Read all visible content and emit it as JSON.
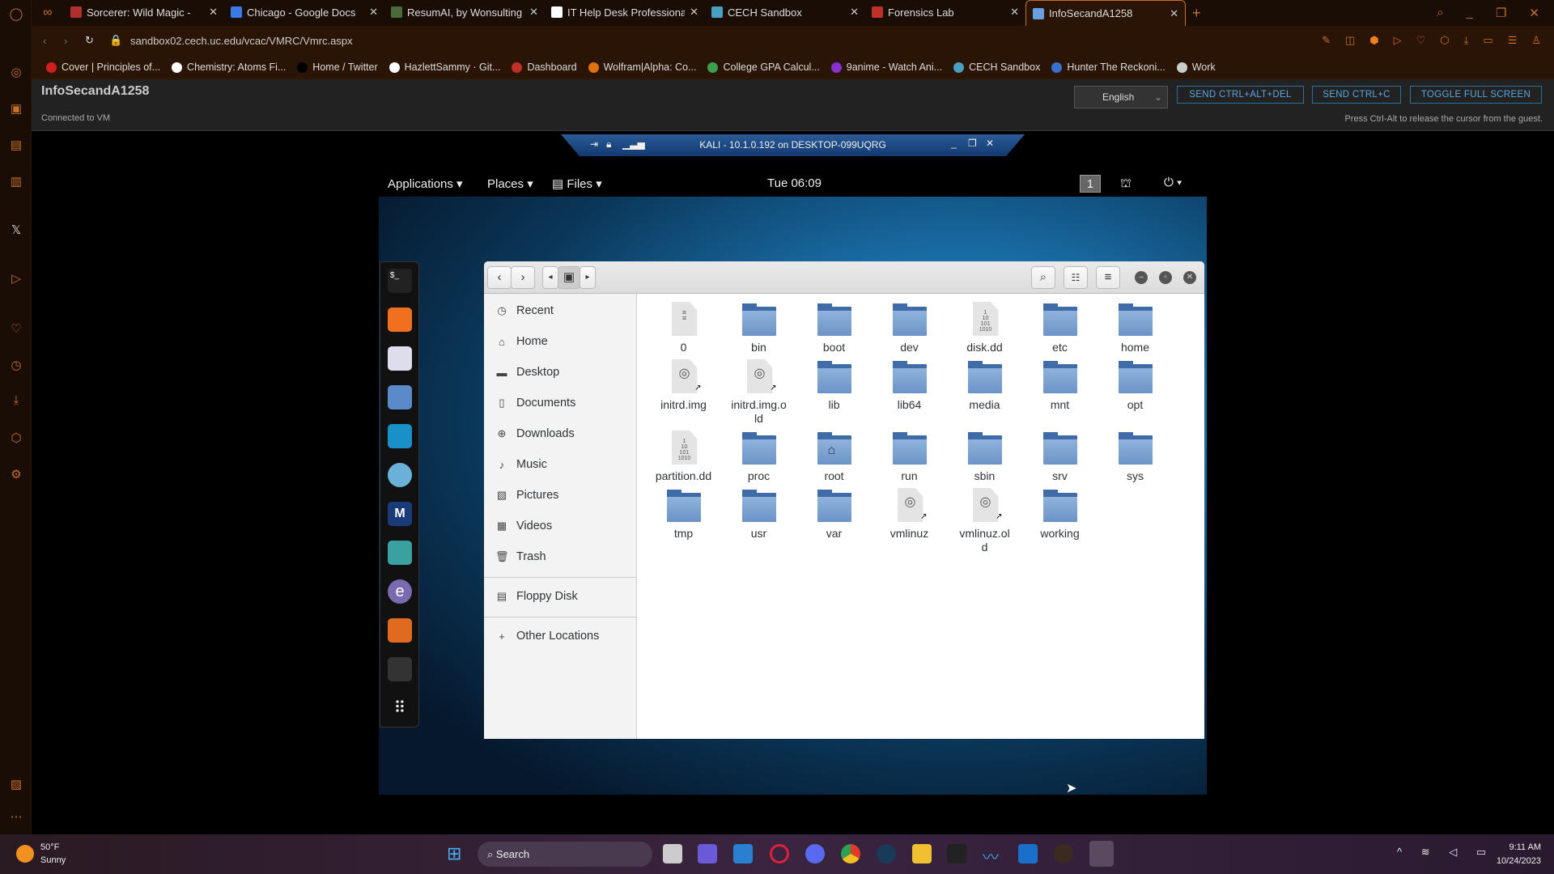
{
  "browser": {
    "tabs": [
      {
        "title": "Sorcerer: Wild Magic -",
        "color": "#b03030"
      },
      {
        "title": "Chicago - Google Docs",
        "color": "#3b7be8"
      },
      {
        "title": "ResumAI, by Wonsulting",
        "color": "#4a6a3a"
      },
      {
        "title": "IT Help Desk Professional",
        "color": "#ffffff"
      },
      {
        "title": "CECH Sandbox",
        "color": "#4aa0c0"
      },
      {
        "title": "Forensics Lab",
        "color": "#c0302a"
      },
      {
        "title": "InfoSecandA1258",
        "color": "#6aa0e0",
        "active": true
      }
    ],
    "url": "sandbox02.cech.uc.edu/vcac/VMRC/Vmrc.aspx",
    "bookmarks": [
      {
        "label": "Cover | Principles of...",
        "color": "#d02020"
      },
      {
        "label": "Chemistry: Atoms Fi...",
        "color": "#ffffff"
      },
      {
        "label": "Home / Twitter",
        "color": "#000000"
      },
      {
        "label": "HazlettSammy · Git...",
        "color": "#ffffff"
      },
      {
        "label": "Dashboard",
        "color": "#c0302a"
      },
      {
        "label": "Wolfram|Alpha: Co...",
        "color": "#e07010"
      },
      {
        "label": "College GPA Calcul...",
        "color": "#3aa050"
      },
      {
        "label": "9anime - Watch Ani...",
        "color": "#8a30d0"
      },
      {
        "label": "CECH Sandbox",
        "color": "#4aa0c0"
      },
      {
        "label": "Hunter The Reckoni...",
        "color": "#3a70d0"
      },
      {
        "label": "Work",
        "color": "#cccccc"
      }
    ],
    "accent": "#c8702a"
  },
  "vmrc": {
    "title": "InfoSecandA1258",
    "status": "Connected to VM",
    "language": "English",
    "send_cad": "SEND CTRL+ALT+DEL",
    "send_cc": "SEND CTRL+C",
    "fullscreen": "TOGGLE FULL SCREEN",
    "hint": "Press Ctrl-Alt to release the cursor from the guest.",
    "conn_title": "KALI - 10.1.0.192 on DESKTOP-099UQRG"
  },
  "kali": {
    "applications": "Applications",
    "places": "Places",
    "files": "Files",
    "clock": "Tue 06:09",
    "workspace": "1"
  },
  "files": {
    "sidebar": [
      {
        "label": "Recent",
        "icon": "clock-icon"
      },
      {
        "label": "Home",
        "icon": "home-icon"
      },
      {
        "label": "Desktop",
        "icon": "desktop-icon"
      },
      {
        "label": "Documents",
        "icon": "document-icon"
      },
      {
        "label": "Downloads",
        "icon": "download-icon"
      },
      {
        "label": "Music",
        "icon": "music-icon"
      },
      {
        "label": "Pictures",
        "icon": "pictures-icon"
      },
      {
        "label": "Videos",
        "icon": "videos-icon"
      },
      {
        "label": "Trash",
        "icon": "trash-icon"
      }
    ],
    "floppy": "Floppy Disk",
    "other": "Other Locations",
    "items": [
      {
        "name": "0",
        "type": "text"
      },
      {
        "name": "bin",
        "type": "folder"
      },
      {
        "name": "boot",
        "type": "folder"
      },
      {
        "name": "dev",
        "type": "folder"
      },
      {
        "name": "disk.dd",
        "type": "binary"
      },
      {
        "name": "etc",
        "type": "folder"
      },
      {
        "name": "home",
        "type": "folder"
      },
      {
        "name": "initrd.img",
        "type": "link"
      },
      {
        "name": "initrd.img.old",
        "type": "link"
      },
      {
        "name": "lib",
        "type": "folder"
      },
      {
        "name": "lib64",
        "type": "folder"
      },
      {
        "name": "media",
        "type": "folder"
      },
      {
        "name": "mnt",
        "type": "folder"
      },
      {
        "name": "opt",
        "type": "folder"
      },
      {
        "name": "partition.dd",
        "type": "binary"
      },
      {
        "name": "proc",
        "type": "folder"
      },
      {
        "name": "root",
        "type": "folder"
      },
      {
        "name": "run",
        "type": "folder"
      },
      {
        "name": "sbin",
        "type": "folder"
      },
      {
        "name": "srv",
        "type": "folder"
      },
      {
        "name": "sys",
        "type": "folder"
      },
      {
        "name": "tmp",
        "type": "folder"
      },
      {
        "name": "usr",
        "type": "folder"
      },
      {
        "name": "var",
        "type": "folder"
      },
      {
        "name": "vmlinuz",
        "type": "link"
      },
      {
        "name": "vmlinuz.old",
        "type": "link"
      },
      {
        "name": "working",
        "type": "folder"
      }
    ]
  },
  "taskbar": {
    "temp": "50°F",
    "weather": "Sunny",
    "search": "Search",
    "time": "9:11 AM",
    "date": "10/24/2023"
  }
}
